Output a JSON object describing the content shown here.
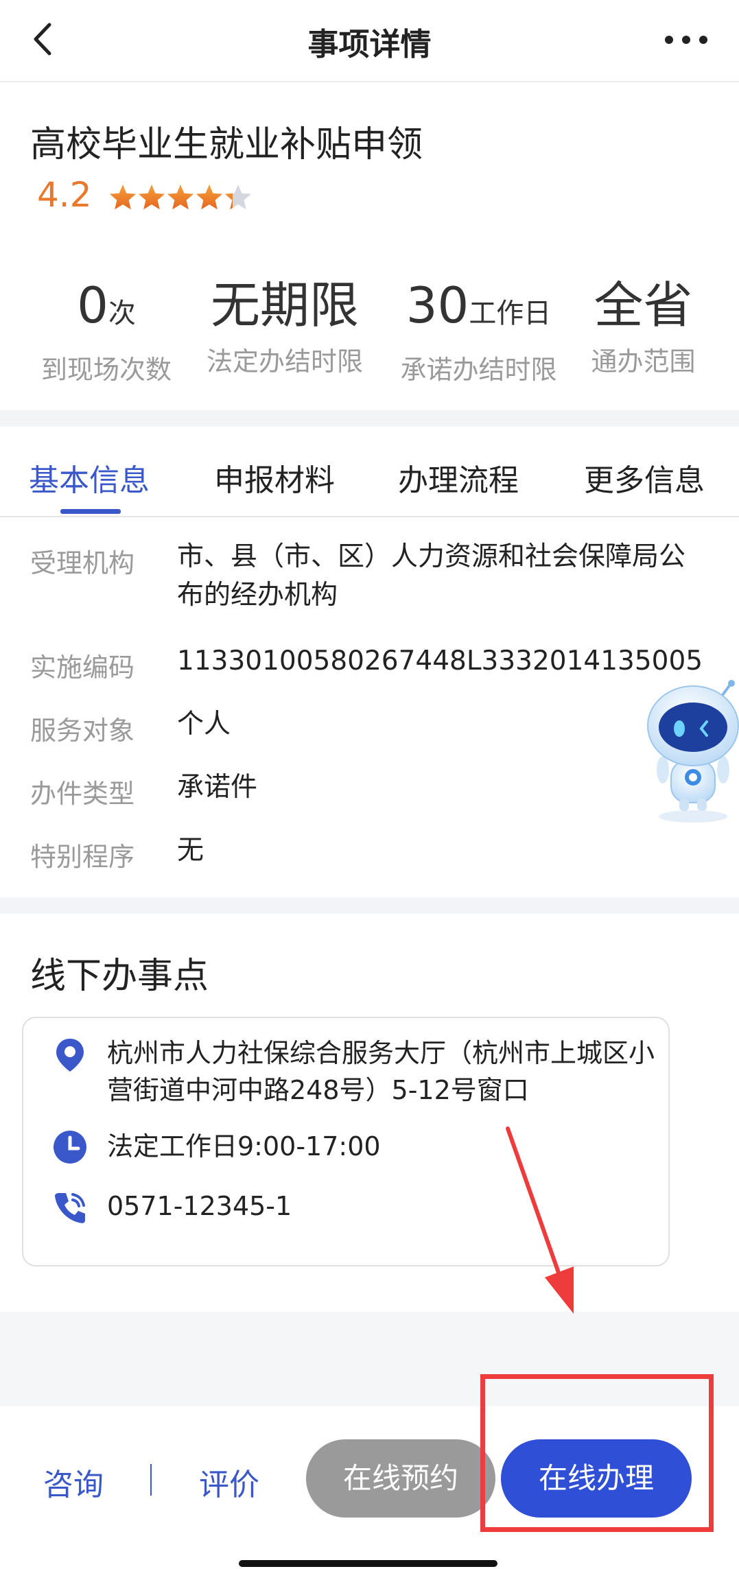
{
  "nav": {
    "title": "事项详情"
  },
  "item": {
    "title": "高校毕业生就业补贴申领",
    "rating": "4.2",
    "stars_filled": 4.2,
    "stars_max": 5
  },
  "stats": [
    {
      "value": "0",
      "unit": "次",
      "label": "到现场次数"
    },
    {
      "value": "无期限",
      "unit": "",
      "label": "法定办结时限"
    },
    {
      "value": "30",
      "unit": "工作日",
      "label": "承诺办结时限"
    },
    {
      "value": "全省",
      "unit": "",
      "label": "通办范围"
    }
  ],
  "tabs": [
    "基本信息",
    "申报材料",
    "办理流程",
    "更多信息"
  ],
  "info": [
    {
      "key": "受理机构",
      "value": "市、县（市、区）人力资源和社会保障局公布的经办机构"
    },
    {
      "key": "实施编码",
      "value": "11330100580267448L3332014135005"
    },
    {
      "key": "服务对象",
      "value": "个人"
    },
    {
      "key": "办件类型",
      "value": "承诺件"
    },
    {
      "key": "特别程序",
      "value": "无"
    }
  ],
  "offline": {
    "title": "线下办事点",
    "address": "杭州市人力社保综合服务大厅（杭州市上城区小营街道中河中路248号）5-12号窗口",
    "hours": "法定工作日9:00-17:00",
    "phone": "0571-12345-1"
  },
  "bottom": {
    "consult": "咨询",
    "evaluate": "评价",
    "reserve": "在线预约",
    "handle": "在线办理"
  },
  "colors": {
    "accent": "#3a58c9",
    "button_blue": "#2e4fd6",
    "rating": "#e9772c",
    "annotation_red": "#ee3b3b"
  }
}
